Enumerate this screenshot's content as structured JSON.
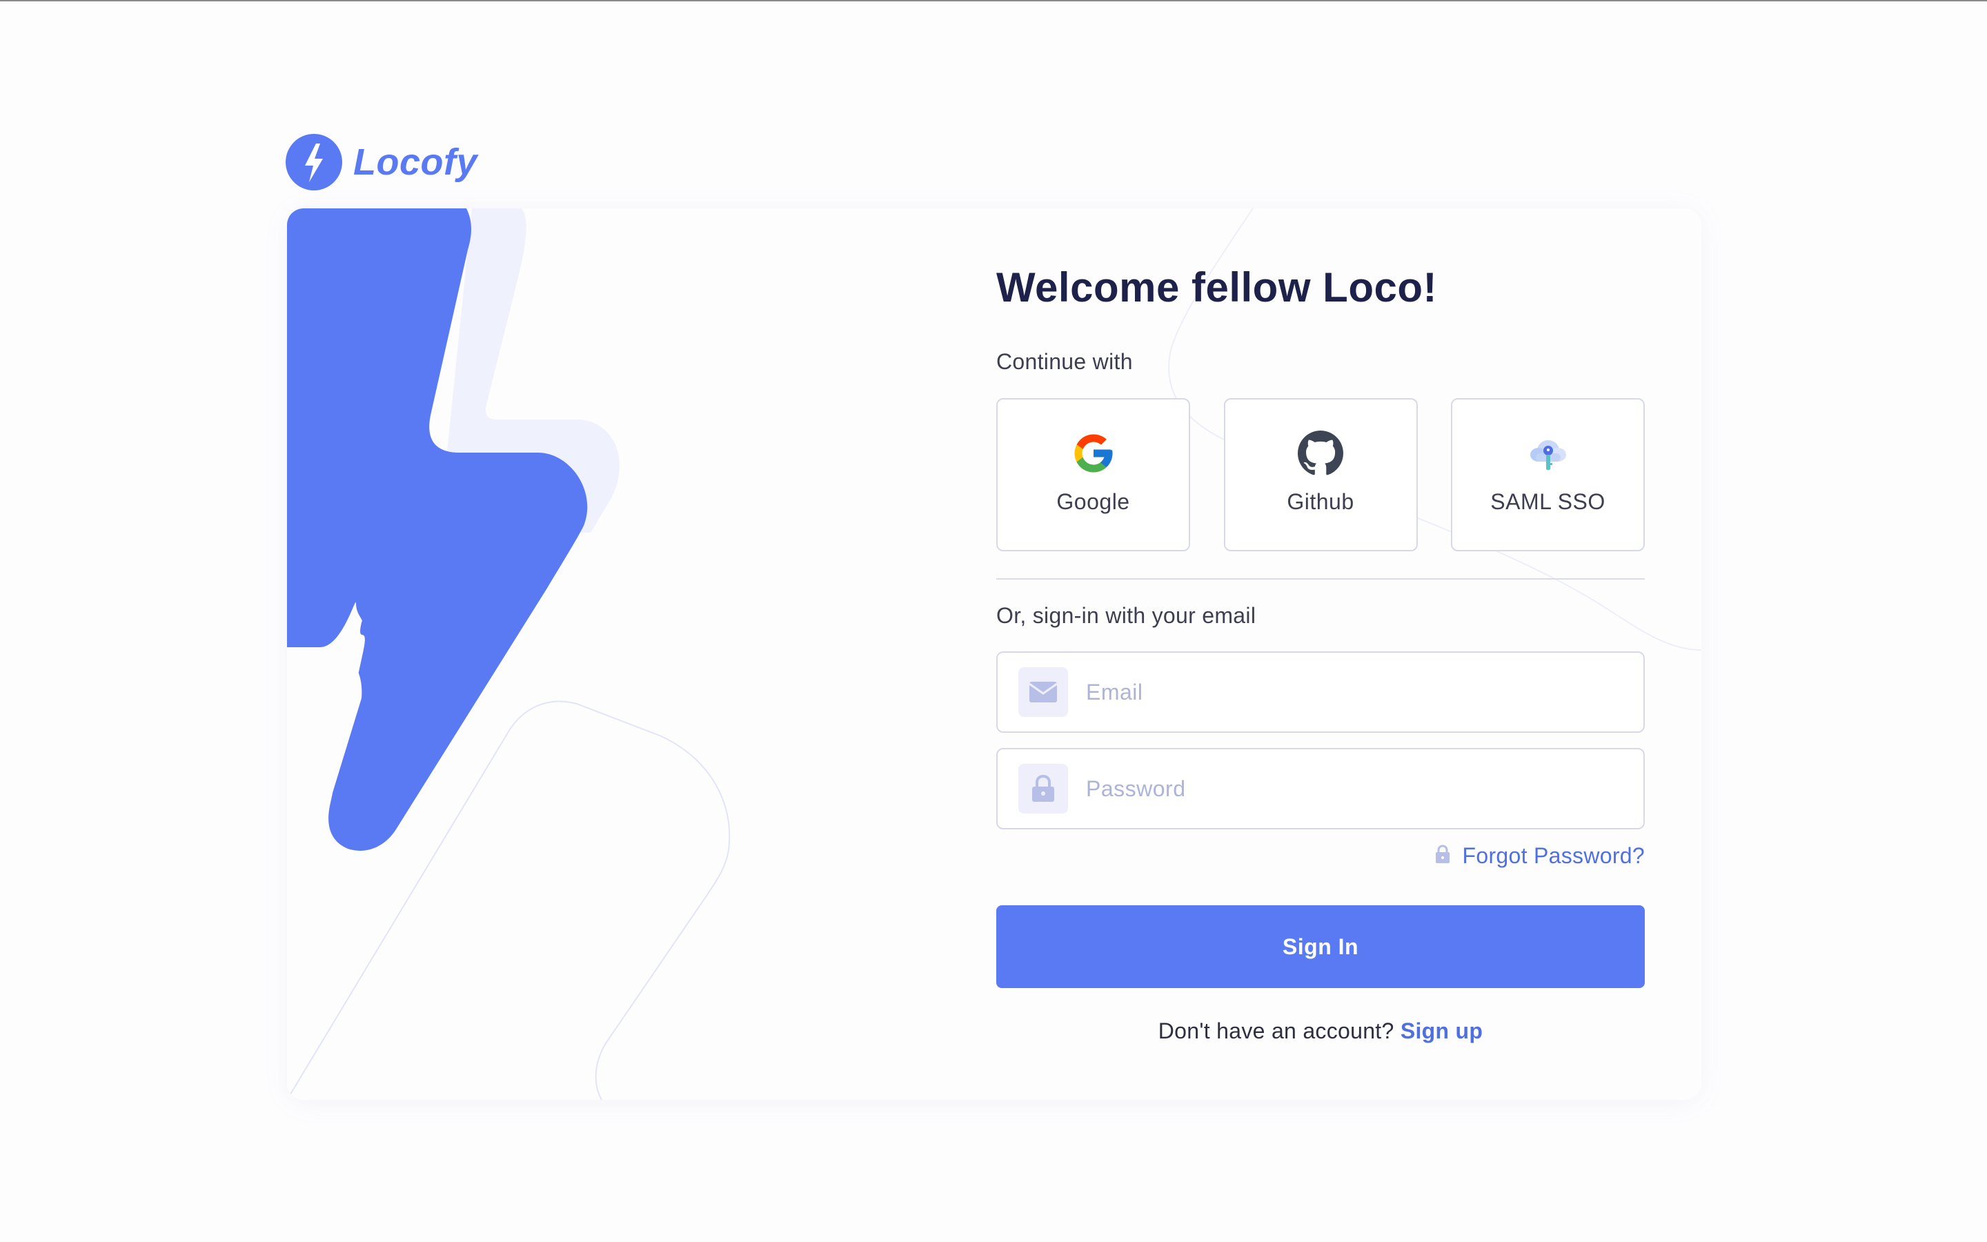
{
  "brand": {
    "name": "Locofy",
    "logo_icon": "lightning-bolt-icon",
    "accent_color": "#5a7af4",
    "link_color": "#5070e0",
    "heading_color": "#1e2149"
  },
  "login": {
    "title": "Welcome fellow Loco!",
    "continue_label": "Continue with",
    "providers": [
      {
        "label": "Google",
        "icon": "google-icon"
      },
      {
        "label": "Github",
        "icon": "github-icon"
      },
      {
        "label": "SAML SSO",
        "icon": "cloud-key-icon"
      }
    ],
    "email_section_label": "Or, sign-in with your email",
    "email": {
      "value": "",
      "placeholder": "Email",
      "icon": "envelope-icon"
    },
    "password": {
      "value": "",
      "placeholder": "Password",
      "icon": "lock-icon"
    },
    "forgot_password": {
      "label": "Forgot Password?",
      "icon": "lock-icon"
    },
    "submit_label": "Sign In",
    "signup_prompt": "Don't have an account?",
    "signup_link": "Sign up"
  }
}
